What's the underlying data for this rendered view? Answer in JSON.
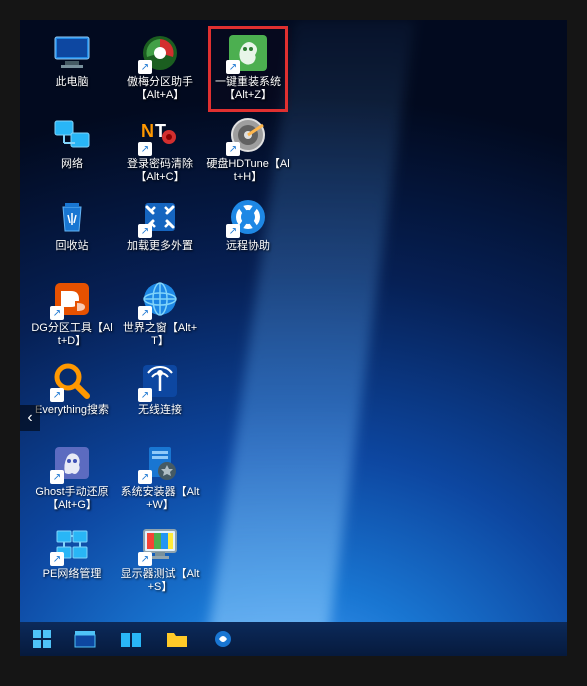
{
  "icons": {
    "this_pc": {
      "label": "此电脑"
    },
    "aomei": {
      "label": "傲梅分区助手【Alt+A】"
    },
    "reinstall": {
      "label": "一键重装系统【Alt+Z】"
    },
    "network": {
      "label": "网络"
    },
    "pwdclear": {
      "label": "登录密码清除【Alt+C】"
    },
    "hdtune": {
      "label": "硬盘HDTune【Alt+H】"
    },
    "recycle": {
      "label": "回收站"
    },
    "loadmore": {
      "label": "加载更多外置"
    },
    "remote": {
      "label": "远程协助"
    },
    "dgpart": {
      "label": "DG分区工具【Alt+D】"
    },
    "world": {
      "label": "世界之窗【Alt+T】"
    },
    "everything": {
      "label": "Everything搜索"
    },
    "wifi": {
      "label": "无线连接"
    },
    "ghost": {
      "label": "Ghost手动还原【Alt+G】"
    },
    "installer": {
      "label": "系统安装器【Alt+W】"
    },
    "penet": {
      "label": "PE网络管理"
    },
    "monitor": {
      "label": "显示器测试【Alt+S】"
    }
  },
  "taskbar": {
    "start": "⊞"
  }
}
